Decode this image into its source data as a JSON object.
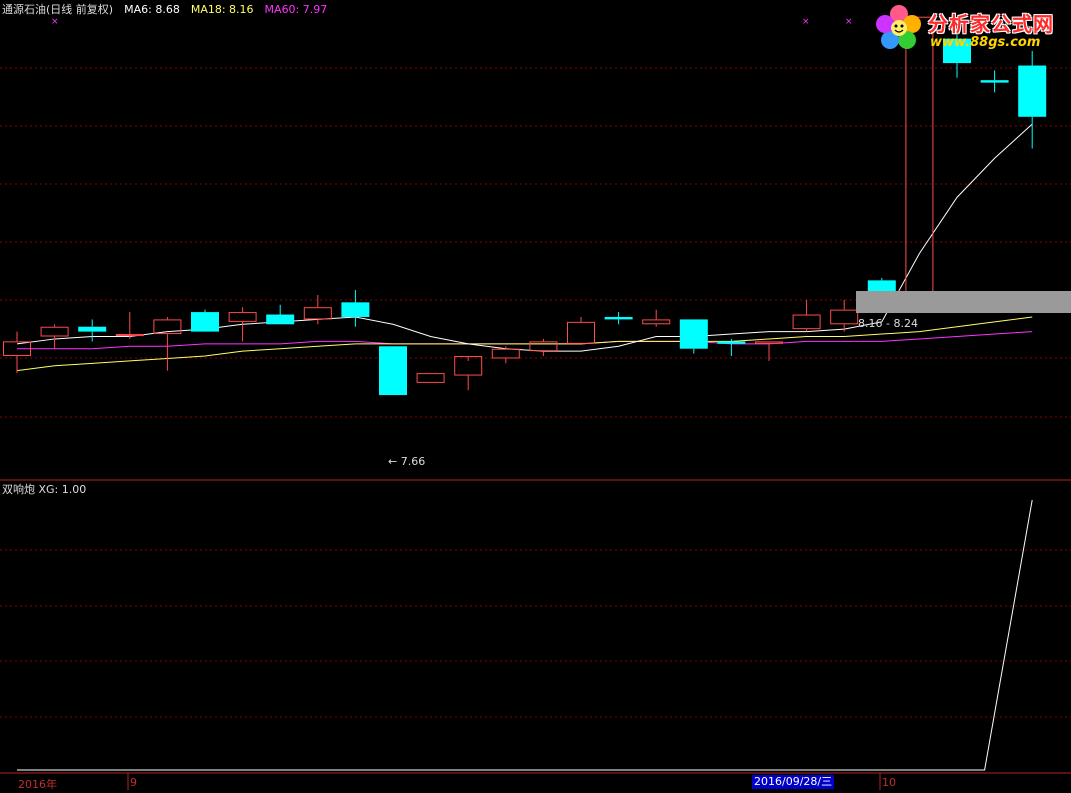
{
  "header": {
    "stock_name": "通源石油(日线 前复权)",
    "ma6_label": "MA6:",
    "ma6_value": "8.68",
    "ma6_color": "#ffffff",
    "ma18_label": "MA18:",
    "ma18_value": "8.16",
    "ma18_color": "#ffff66",
    "ma60_label": "MA60:",
    "ma60_value": "7.97",
    "ma60_color": "#ff33ff"
  },
  "indicator": {
    "name": "双响炮",
    "xg_label": "XG:",
    "xg_value": "1.00"
  },
  "logo": {
    "text": "分析家公式网",
    "url": "www.88gs.com"
  },
  "annotations": {
    "low_label": "← 7.66",
    "range_label": "8.16 - 8.24"
  },
  "xaxis": {
    "year_label": "2016年",
    "month1": "9",
    "month2": "10",
    "date_tip": "2016/09/28/三"
  },
  "colors": {
    "up": "#ff4b4b",
    "down": "#00ffff",
    "grid": "#8b0000",
    "ma6": "#ffffff",
    "ma18": "#ffff66",
    "ma60": "#ff33ff"
  },
  "chart_data": [
    {
      "type": "candlestick",
      "y_range": [
        7.6,
        9.3
      ],
      "candles": [
        {
          "o": 8.03,
          "h": 8.13,
          "l": 7.96,
          "c": 8.09
        },
        {
          "o": 8.11,
          "h": 8.16,
          "l": 8.06,
          "c": 8.15
        },
        {
          "o": 8.15,
          "h": 8.18,
          "l": 8.09,
          "c": 8.13
        },
        {
          "o": 8.12,
          "h": 8.21,
          "l": 8.1,
          "c": 8.12
        },
        {
          "o": 8.12,
          "h": 8.19,
          "l": 7.97,
          "c": 8.18
        },
        {
          "o": 8.21,
          "h": 8.22,
          "l": 8.13,
          "c": 8.13
        },
        {
          "o": 8.17,
          "h": 8.23,
          "l": 8.09,
          "c": 8.21
        },
        {
          "o": 8.2,
          "h": 8.24,
          "l": 8.16,
          "c": 8.16
        },
        {
          "o": 8.18,
          "h": 8.28,
          "l": 8.16,
          "c": 8.23
        },
        {
          "o": 8.25,
          "h": 8.3,
          "l": 8.15,
          "c": 8.19
        },
        {
          "o": 8.07,
          "h": 8.07,
          "l": 7.87,
          "c": 7.87
        },
        {
          "o": 7.92,
          "h": 7.96,
          "l": 7.92,
          "c": 7.96
        },
        {
          "o": 7.95,
          "h": 8.01,
          "l": 7.89,
          "c": 8.03
        },
        {
          "o": 8.02,
          "h": 8.07,
          "l": 8.0,
          "c": 8.06
        },
        {
          "o": 8.05,
          "h": 8.1,
          "l": 8.03,
          "c": 8.09
        },
        {
          "o": 8.08,
          "h": 8.19,
          "l": 8.08,
          "c": 8.17
        },
        {
          "o": 8.19,
          "h": 8.21,
          "l": 8.16,
          "c": 8.18
        },
        {
          "o": 8.16,
          "h": 8.22,
          "l": 8.15,
          "c": 8.18
        },
        {
          "o": 8.18,
          "h": 8.18,
          "l": 8.04,
          "c": 8.06
        },
        {
          "o": 8.09,
          "h": 8.1,
          "l": 8.03,
          "c": 8.08
        },
        {
          "o": 8.08,
          "h": 8.09,
          "l": 8.01,
          "c": 8.09
        },
        {
          "o": 8.14,
          "h": 8.26,
          "l": 8.13,
          "c": 8.2
        },
        {
          "o": 8.16,
          "h": 8.26,
          "l": 8.13,
          "c": 8.22
        },
        {
          "o": 8.34,
          "h": 8.35,
          "l": 8.25,
          "c": 8.27
        },
        {
          "o": 8.23,
          "h": 9.42,
          "l": 8.23,
          "c": 9.42
        },
        {
          "o": 9.33,
          "h": 9.36,
          "l": 9.17,
          "c": 9.23
        },
        {
          "o": 9.16,
          "h": 9.2,
          "l": 9.11,
          "c": 9.15
        },
        {
          "o": 9.22,
          "h": 9.28,
          "l": 8.88,
          "c": 9.01
        }
      ],
      "ma6": [
        8.08,
        8.1,
        8.11,
        8.11,
        8.13,
        8.14,
        8.16,
        8.17,
        8.18,
        8.19,
        8.16,
        8.11,
        8.08,
        8.06,
        8.05,
        8.05,
        8.07,
        8.11,
        8.11,
        8.12,
        8.13,
        8.13,
        8.14,
        8.17,
        8.45,
        8.68,
        8.84,
        8.98
      ],
      "ma18": [
        7.97,
        7.99,
        8.0,
        8.01,
        8.02,
        8.03,
        8.05,
        8.06,
        8.07,
        8.08,
        8.08,
        8.08,
        8.08,
        8.08,
        8.08,
        8.08,
        8.09,
        8.09,
        8.09,
        8.09,
        8.1,
        8.11,
        8.11,
        8.12,
        8.13,
        8.15,
        8.17,
        8.19
      ],
      "ma60": [
        8.06,
        8.06,
        8.06,
        8.07,
        8.07,
        8.08,
        8.08,
        8.08,
        8.09,
        8.09,
        8.08,
        8.08,
        8.08,
        8.08,
        8.08,
        8.08,
        8.09,
        8.09,
        8.09,
        8.08,
        8.08,
        8.09,
        8.09,
        8.09,
        8.1,
        8.11,
        8.12,
        8.13
      ]
    },
    {
      "type": "line",
      "name": "XG",
      "y_range": [
        0,
        1
      ],
      "values": [
        0,
        0,
        0,
        0,
        0,
        0,
        0,
        0,
        0,
        0,
        0,
        0,
        0,
        0,
        0,
        0,
        0,
        0,
        0,
        0,
        0,
        0,
        0,
        0,
        0,
        0,
        0,
        1
      ]
    }
  ]
}
